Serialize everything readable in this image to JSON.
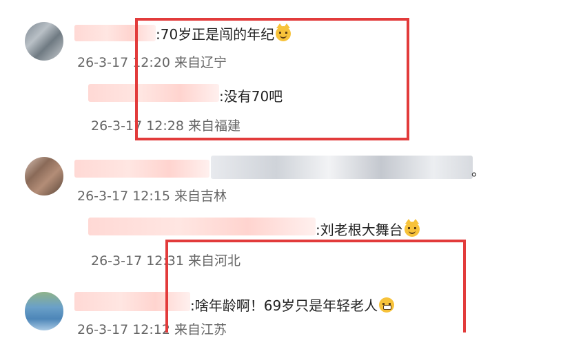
{
  "comments": [
    {
      "text": ":70岁正是闯的年纪",
      "meta": "26-3-17  12:20 来自辽宁",
      "emoji": "cat-face-icon",
      "reply": {
        "text": ":没有70吧",
        "meta": "26-3-17  12:28 来自福建"
      }
    },
    {
      "text": "。",
      "meta": "26-3-17  12:15 来自吉林",
      "reply": {
        "text": ":刘老根大舞台",
        "meta": "26-3-17  12:31 来自河北",
        "emoji": "cat-face-icon"
      }
    },
    {
      "text": ":啥年龄啊！69岁只是年轻老人",
      "meta": "26-3-17  12:12 来自江苏",
      "emoji": "grinning-face-icon"
    }
  ],
  "colors": {
    "highlight_box": "#e23b3b",
    "meta_text": "#666666"
  }
}
